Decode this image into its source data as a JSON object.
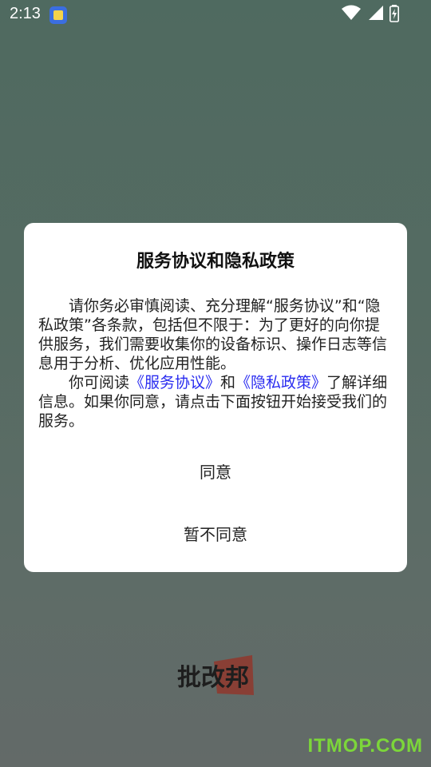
{
  "status_bar": {
    "time": "2:13",
    "icons": [
      "app-notification-icon",
      "wifi-icon",
      "signal-icon",
      "battery-charging-icon"
    ]
  },
  "dialog": {
    "title": "服务协议和隐私政策",
    "paragraph1": "请你务必审慎阅读、充分理解“服务协议”和“隐私政策”各条款，包括但不限于：为了更好的向你提供服务，我们需要收集你的设备标识、操作日志等信息用于分析、优化应用性能。",
    "p2_prefix": "你可阅读",
    "p2_link1": "《服务协议》",
    "p2_mid": "和",
    "p2_link2": "《隐私政策》",
    "p2_suffix": "了解详细信息。如果你同意，请点击下面按钮开始接受我们的服务。",
    "agree_label": "同意",
    "disagree_label": "暂不同意"
  },
  "splash": {
    "logo_text": "批改邦"
  },
  "watermark": "ITMOP.COM",
  "colors": {
    "link": "#2a2cf0",
    "watermark": "#7cd63a",
    "logo_accent": "#c0392b"
  }
}
